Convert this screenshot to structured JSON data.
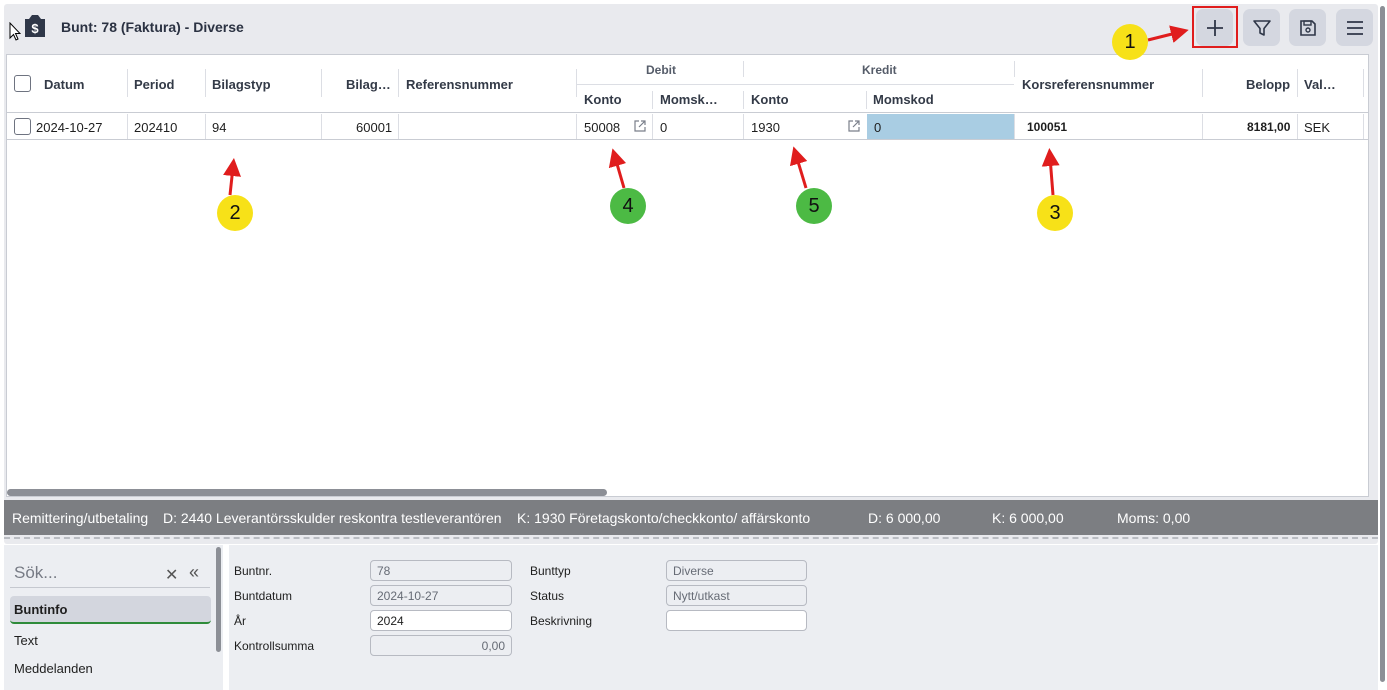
{
  "header": {
    "title": "Bunt: 78 (Faktura) - Diverse",
    "icon": "invoice-bag-icon",
    "toolbar": [
      "add-icon",
      "filter-icon",
      "save-icon",
      "menu-icon"
    ]
  },
  "grid": {
    "columns": {
      "datum": "Datum",
      "period": "Period",
      "bilagstyp": "Bilagstyp",
      "bilag": "Bilag…",
      "referensnummer": "Referensnummer",
      "debit": "Debit",
      "debit_konto": "Konto",
      "debit_momskod": "Momsk…",
      "kredit": "Kredit",
      "kredit_konto": "Konto",
      "kredit_momskod": "Momskod",
      "korsreferensnummer": "Korsreferensnummer",
      "belopp": "Belopp",
      "valuta": "Val…"
    },
    "row": {
      "datum": "2024-10-27",
      "period": "202410",
      "bilagstyp": "94",
      "bilag": "60001",
      "referensnummer": "",
      "debit_konto": "50008",
      "debit_momskod": "0",
      "kredit_konto": "1930",
      "kredit_momskod": "0",
      "korsreferensnummer": "100051",
      "belopp": "8181,00",
      "valuta": "SEK"
    }
  },
  "status_bar": {
    "type": "Remittering/utbetaling",
    "debit_account": "D: 2440 Leverantörsskulder reskontra testleverantören",
    "credit_account": "K: 1930 Företagskonto/checkkonto/ affärskonto",
    "debit_total": "D: 6 000,00",
    "credit_total": "K: 6 000,00",
    "vat": "Moms: 0,00"
  },
  "side_nav": {
    "search_placeholder": "Sök...",
    "items": [
      "Buntinfo",
      "Text",
      "Meddelanden"
    ]
  },
  "form": {
    "buntnr_label": "Buntnr.",
    "buntnr": "78",
    "buntdatum_label": "Buntdatum",
    "buntdatum": "2024-10-27",
    "ar_label": "År",
    "ar": "2024",
    "kontrollsumma_label": "Kontrollsumma",
    "kontrollsumma": "0,00",
    "bunttyp_label": "Bunttyp",
    "bunttyp": "Diverse",
    "status_label": "Status",
    "status": "Nytt/utkast",
    "beskrivning_label": "Beskrivning",
    "beskrivning": ""
  },
  "annotations": {
    "badges": [
      "1",
      "2",
      "3",
      "4",
      "5"
    ],
    "colors": {
      "yellow": "#f7e118",
      "green": "#4cba44",
      "arrow": "#e01d1d"
    }
  }
}
